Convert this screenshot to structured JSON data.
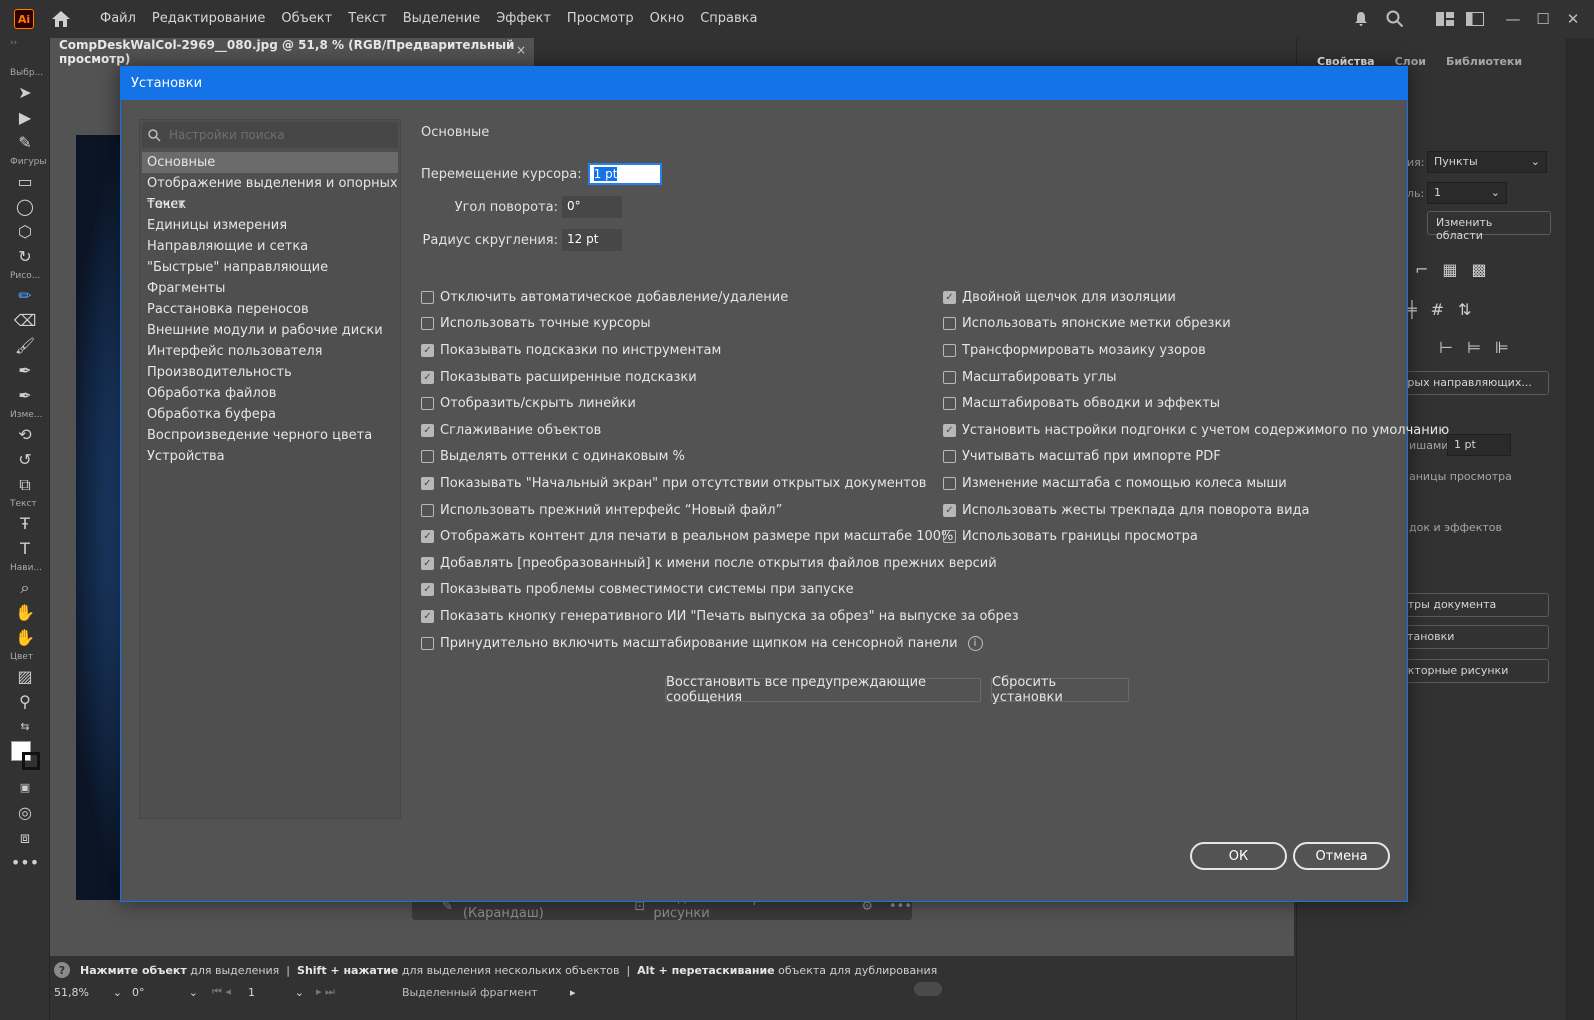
{
  "app": {
    "logo": "Ai"
  },
  "menu": [
    "Файл",
    "Редактирование",
    "Объект",
    "Текст",
    "Выделение",
    "Эффект",
    "Просмотр",
    "Окно",
    "Справка"
  ],
  "menubar_icons": [
    "bell-icon",
    "search-icon",
    "workspace-icon",
    "arrange-icon",
    "minimize-icon",
    "maximize-icon",
    "close-icon"
  ],
  "toolbar": {
    "groups": [
      "Выбр...",
      "Фигуры",
      "Рисо...",
      "Изме...",
      "Текст",
      "Нави...",
      "Цвет"
    ]
  },
  "document_tab": {
    "title": "CompDeskWalCol-2969__080.jpg @ 51,8 % (RGB/Предварительный просмотр)",
    "close": "×"
  },
  "right_panel": {
    "tabs": [
      "Свойства",
      "Слои",
      "Библиотеки"
    ],
    "units_label": "ия:",
    "units_value": "Пункты",
    "artboard_label": "ль:",
    "artboard_value": "1",
    "edit_artboards": "Изменить области",
    "guides_button": "трых направляющих...",
    "keyboard_increment_label": "ишами:",
    "keyboard_increment_value": "1 pt",
    "view_bounds": "аницы просмотра",
    "strokes_effects": "док и эффектов",
    "doc_setup": "етры документа",
    "preferences": "становки",
    "vector_art": "екторные рисунки"
  },
  "context_bar": {
    "draw": "Рисование (Карандаш)",
    "vectorize": "Создать векторные рисунки"
  },
  "status": {
    "hint_click": "Нажмите объект",
    "hint_click_tail": "для выделения",
    "hint_shift": "Shift + нажатие",
    "hint_shift_tail": "для выделения нескольких объектов",
    "hint_alt": "Alt + перетаскивание",
    "hint_alt_tail": "объекта для дублирования",
    "zoom": "51,8%",
    "rotation": "0°",
    "artboard": "1",
    "selection_info": "Выделенный фрагмент"
  },
  "dialog": {
    "title": "Установки",
    "search_placeholder": "Настройки поиска",
    "nav": [
      "Основные",
      "Отображение выделения и опорных точек",
      "Текст",
      "Единицы измерения",
      "Направляющие и сетка",
      "\"Быстрые\" направляющие",
      "Фрагменты",
      "Расстановка переносов",
      "Внешние модули и рабочие диски",
      "Интерфейс пользователя",
      "Производительность",
      "Обработка файлов",
      "Обработка буфера",
      "Воспроизведение черного цвета",
      "Устройства"
    ],
    "section": "Основные",
    "fields": {
      "cursor_label": "Перемещение курсора:",
      "cursor_value": "1 pt",
      "angle_label": "Угол поворота:",
      "angle_value": "0°",
      "radius_label": "Радиус скругления:",
      "radius_value": "12 pt"
    },
    "left_checks": [
      {
        "label": "Отключить автоматическое добавление/удаление",
        "checked": false
      },
      {
        "label": "Использовать точные курсоры",
        "checked": false
      },
      {
        "label": "Показывать подсказки по инструментам",
        "checked": true
      },
      {
        "label": "Показывать расширенные подсказки",
        "checked": true
      },
      {
        "label": "Отобразить/скрыть линейки",
        "checked": false
      },
      {
        "label": "Сглаживание объектов",
        "checked": true
      },
      {
        "label": "Выделять оттенки с одинаковым %",
        "checked": false
      },
      {
        "label": "Показывать \"Начальный экран\" при отсутствии открытых документов",
        "checked": true
      },
      {
        "label": "Использовать прежний интерфейс “Новый файл”",
        "checked": false
      },
      {
        "label": "Отображать контент для печати в реальном размере при масштабе 100%",
        "checked": true
      },
      {
        "label": "Добавлять [преобразованный] к имени после открытия файлов прежних версий",
        "checked": true
      },
      {
        "label": "Показывать проблемы совместимости системы при запуске",
        "checked": true
      },
      {
        "label": "Показать кнопку генеративного ИИ \"Печать выпуска за обрез\" на выпуске за обрез",
        "checked": true
      },
      {
        "label": "Принудительно включить масштабирование щипком на сенсорной панели",
        "checked": false
      }
    ],
    "right_checks": [
      {
        "label": "Двойной щелчок для изоляции",
        "checked": true
      },
      {
        "label": "Использовать японские метки обрезки",
        "checked": false
      },
      {
        "label": "Трансформировать мозаику узоров",
        "checked": false
      },
      {
        "label": "Масштабировать углы",
        "checked": false
      },
      {
        "label": "Масштабировать обводки и эффекты",
        "checked": false
      },
      {
        "label": "Установить настройки подгонки с учетом содержимого по умолчанию",
        "checked": true
      },
      {
        "label": "Учитывать масштаб при импорте PDF",
        "checked": false
      },
      {
        "label": "Изменение масштаба с помощью колеса мыши",
        "checked": false
      },
      {
        "label": "Использовать жесты трекпада для поворота вида",
        "checked": true
      },
      {
        "label": "Использовать границы просмотра",
        "checked": false
      }
    ],
    "info_glyph": "i",
    "restore_warnings": "Восстановить все предупреждающие сообщения",
    "reset_prefs": "Сбросить установки",
    "ok": "ОК",
    "cancel": "Отмена"
  }
}
